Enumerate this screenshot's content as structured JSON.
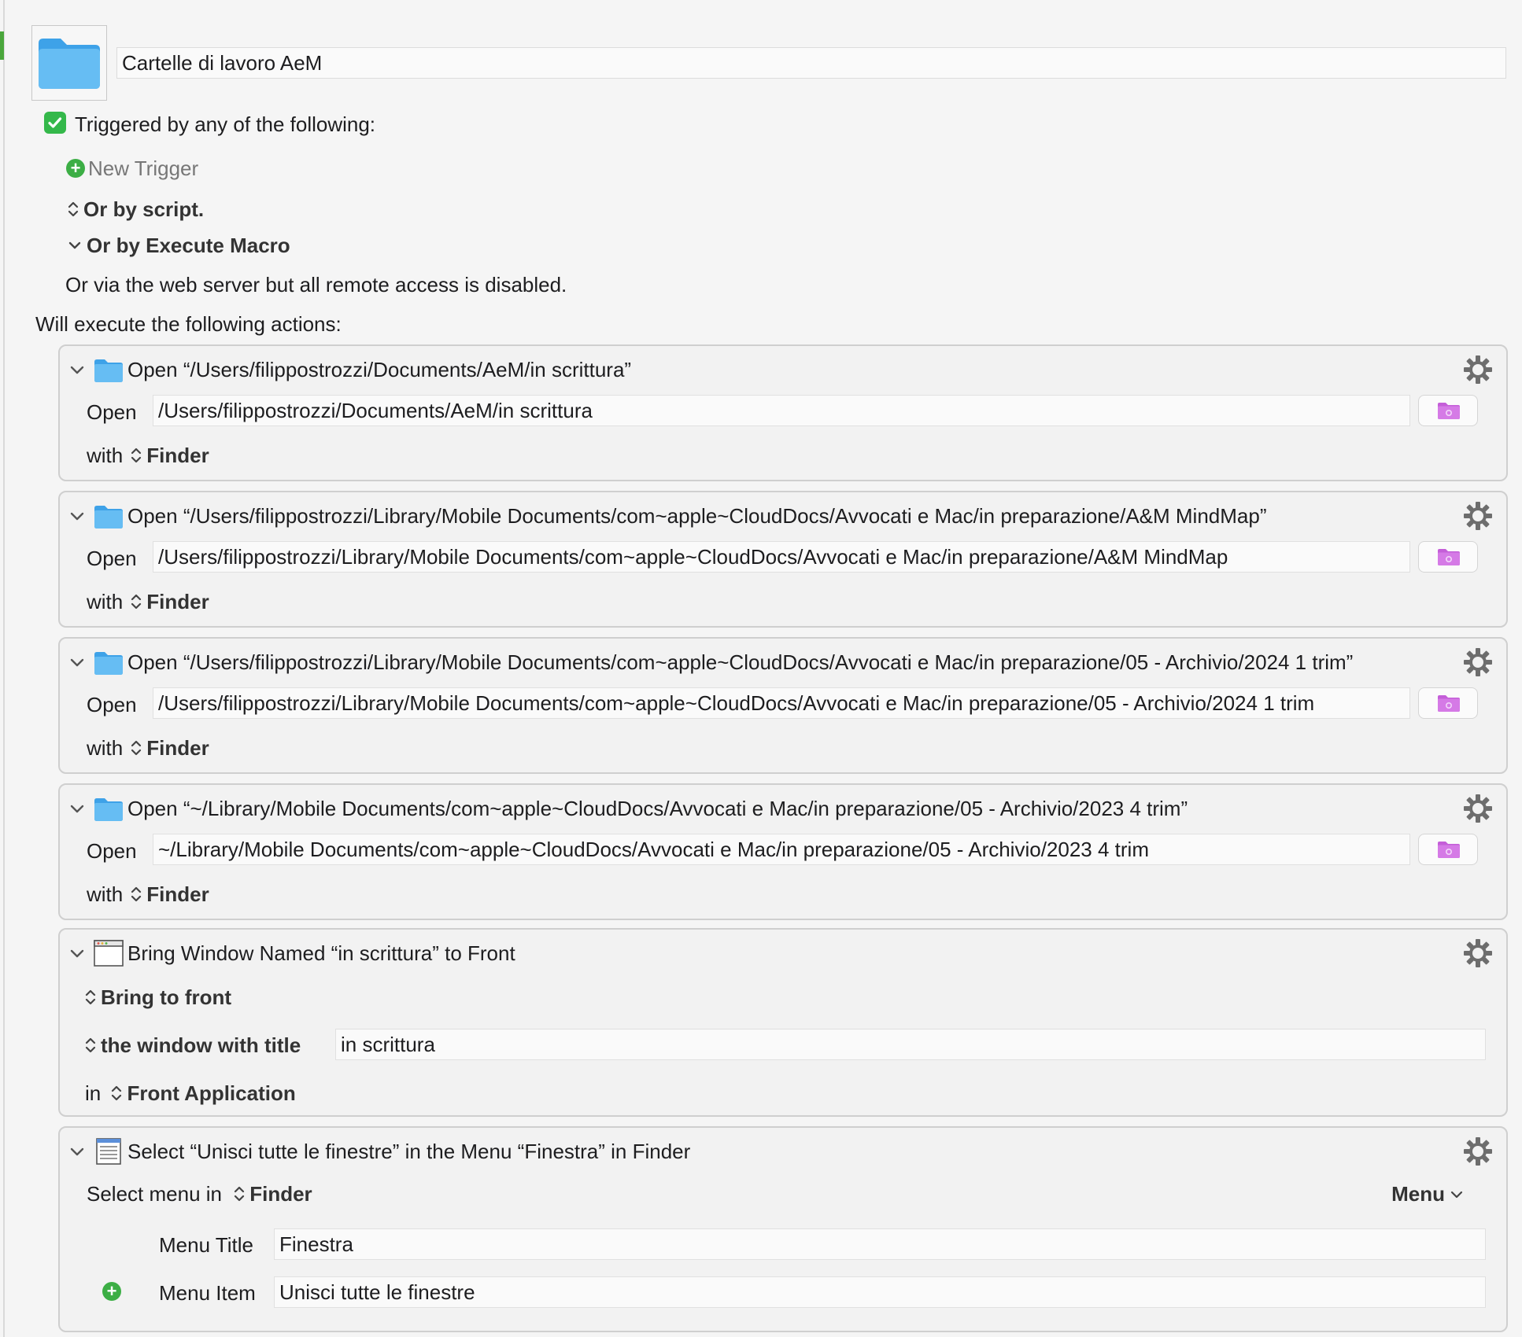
{
  "macro": {
    "name": "Cartelle di lavoro AeM",
    "icon": "folder-icon"
  },
  "triggers": {
    "enabled_label": "Triggered by any of the following:",
    "new_trigger": "New Trigger",
    "or_by_script": "Or by script.",
    "or_by_execute_macro": "Or by Execute Macro",
    "web_server_note": "Or via the web server but all remote access is disabled."
  },
  "actions_header": "Will execute the following actions:",
  "open_actions": [
    {
      "title": "Open “/Users/filippostrozzi/Documents/AeM/in scrittura”",
      "open_label": "Open",
      "path": "/Users/filippostrozzi/Documents/AeM/in scrittura",
      "with_label": "with",
      "app": "Finder"
    },
    {
      "title": "Open “/Users/filippostrozzi/Library/Mobile Documents/com~apple~CloudDocs/Avvocati e Mac/in preparazione/A&M MindMap”",
      "open_label": "Open",
      "path": "/Users/filippostrozzi/Library/Mobile Documents/com~apple~CloudDocs/Avvocati e Mac/in preparazione/A&M MindMap",
      "with_label": "with",
      "app": "Finder"
    },
    {
      "title": "Open “/Users/filippostrozzi/Library/Mobile Documents/com~apple~CloudDocs/Avvocati e Mac/in preparazione/05 - Archivio/2024 1 trim”",
      "open_label": "Open",
      "path": "/Users/filippostrozzi/Library/Mobile Documents/com~apple~CloudDocs/Avvocati e Mac/in preparazione/05 - Archivio/2024 1 trim",
      "with_label": "with",
      "app": "Finder"
    },
    {
      "title": "Open “~/Library/Mobile Documents/com~apple~CloudDocs/Avvocati e Mac/in preparazione/05 - Archivio/2023 4 trim”",
      "open_label": "Open",
      "path": "~/Library/Mobile Documents/com~apple~CloudDocs/Avvocati e Mac/in preparazione/05 - Archivio/2023 4 trim",
      "with_label": "with",
      "app": "Finder"
    }
  ],
  "bring_window": {
    "title": "Bring Window Named “in scrittura” to Front",
    "mode": "Bring to front",
    "match": "the window with title",
    "window_title": "in scrittura",
    "in_label": "in",
    "application": "Front Application"
  },
  "select_menu": {
    "title": "Select “Unisci tutte le finestre” in the Menu “Finestra” in Finder",
    "select_menu_in": "Select menu in",
    "app": "Finder",
    "menu_dropdown": "Menu",
    "menu_title_label": "Menu Title",
    "menu_title_value": "Finestra",
    "menu_item_label": "Menu Item",
    "menu_item_value": "Unisci tutte le finestre"
  },
  "colors": {
    "accent_green": "#34b84a",
    "folder_blue": "#5ab6f0",
    "folder_button_purple": "#c45ed8"
  }
}
